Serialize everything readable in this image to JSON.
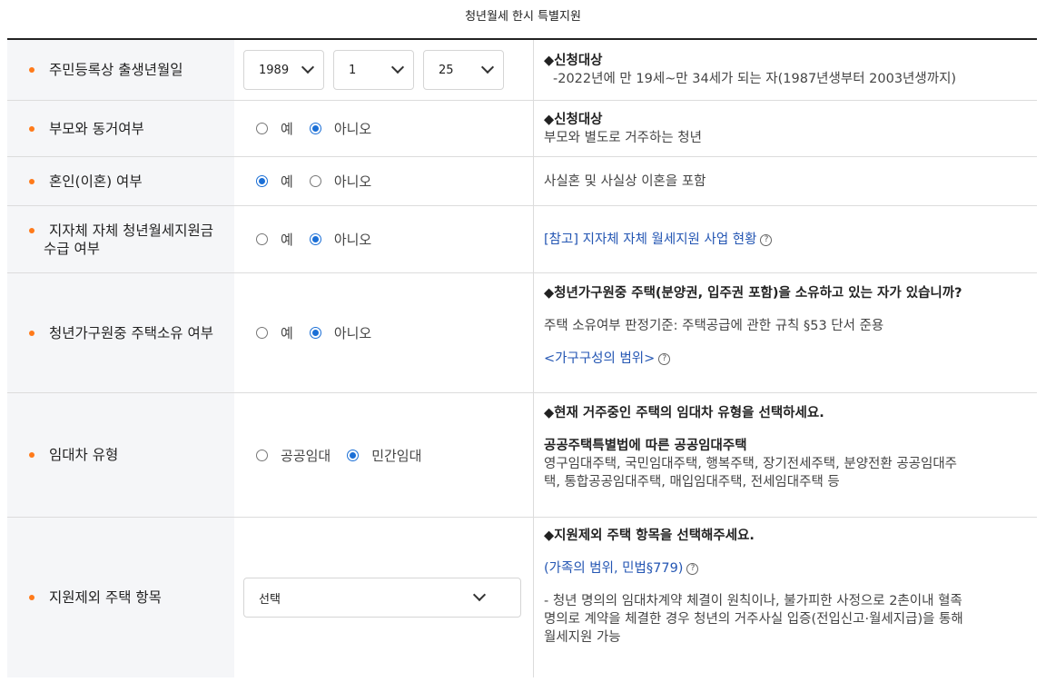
{
  "title": "청년월세 한시 특별지원",
  "rows": {
    "birth": {
      "label": "주민등록상 출생년월일",
      "year": "1989",
      "month": "1",
      "day": "25",
      "desc_head": "◆신청대상",
      "desc_text": "-2022년에 만 19세~만 34세가 되는 자(1987년생부터 2003년생까지)"
    },
    "cohabit": {
      "label": "부모와 동거여부",
      "opt_yes": "예",
      "opt_no": "아니오",
      "selected": "아니오",
      "desc_head": "◆신청대상",
      "desc_text": "부모와 별도로 거주하는 청년"
    },
    "marriage": {
      "label": "혼인(이혼) 여부",
      "opt_yes": "예",
      "opt_no": "아니오",
      "selected": "예",
      "desc_text": "사실혼 및 사실상 이혼을 포함"
    },
    "local": {
      "label_line1": "지자체 자체 청년월세지원금",
      "label_line2": "수급 여부",
      "opt_yes": "예",
      "opt_no": "아니오",
      "selected": "아니오",
      "desc_link": "[참고] 지자체 자체 월세지원 사업 현황"
    },
    "house": {
      "label": "청년가구원중 주택소유 여부",
      "opt_yes": "예",
      "opt_no": "아니오",
      "selected": "아니오",
      "desc_head": "◆청년가구원중 주택(분양권, 입주권 포함)을 소유하고 있는 자가 있습니까?",
      "desc_text": "주택 소유여부 판정기준: 주택공급에 관한 규칙 §53 단서 준용",
      "desc_link": "<가구구성의 범위>"
    },
    "lease": {
      "label": "임대차 유형",
      "opt_public": "공공임대",
      "opt_private": "민간임대",
      "selected": "민간임대",
      "desc_head": "◆현재 거주중인 주택의 임대차 유형을 선택하세요.",
      "desc_sub_head": "공공주택특별법에 따른 공공임대주택",
      "desc_text_1": "영구임대주택, 국민임대주택, 행복주택, 장기전세주택, 분양전환 공공임대주",
      "desc_text_2": "택, 통합공공임대주택, 매입임대주택, 전세임대주택 등"
    },
    "exclude": {
      "label": "지원제외 주택 항목",
      "select_value": "선택",
      "desc_head": "◆지원제외 주택 항목을 선택해주세요.",
      "desc_link": "(가족의 범위, 민법§779)",
      "desc_text_1": "- 청년 명의의 임대차계약 체결이 원칙이나, 불가피한 사정으로 2촌이내 혈족",
      "desc_text_2": "명의로 계약을 체결한 경우 청년의 거주사실 입증(전입신고·월세지급)을 통해",
      "desc_text_3": "월세지원 가능"
    }
  },
  "help_icon": "?",
  "colors": {
    "accent_dot": "#ff7a1a",
    "radio_on": "#1b6fd6",
    "label_bg": "#f5f6f8",
    "link": "#2456b3"
  }
}
